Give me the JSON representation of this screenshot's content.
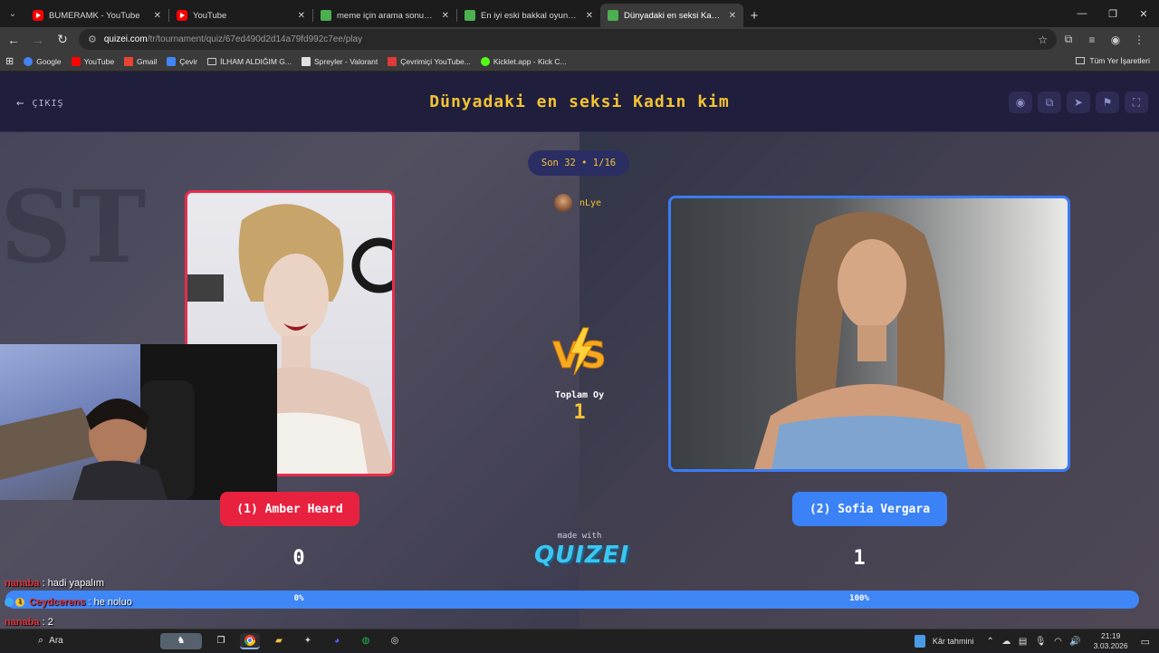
{
  "browser": {
    "tabs": [
      {
        "title": "BUMERAMK - YouTube",
        "icon": "youtube-icon",
        "active": false
      },
      {
        "title": "YouTube",
        "icon": "youtube-icon",
        "active": false
      },
      {
        "title": "meme için arama sonuçları - Q",
        "icon": "quizei-icon",
        "active": false
      },
      {
        "title": "En iyi eski bakkal oyuncakları -",
        "icon": "quizei-icon",
        "active": false
      },
      {
        "title": "Dünyadaki en seksi Kadın kim -",
        "icon": "quizei-icon",
        "active": true
      }
    ],
    "url_domain": "quizei.com",
    "url_path": "/tr/tournament/quiz/67ed490d2d14a79fd992c7ee/play",
    "bookmarks": [
      {
        "label": "Google",
        "color": "#4285f4"
      },
      {
        "label": "YouTube",
        "color": "#ff0000"
      },
      {
        "label": "Gmail",
        "color": "#ea4335"
      },
      {
        "label": "Çevir",
        "color": "#4285f4"
      },
      {
        "label": "İLHAM ALDIĞIM G...",
        "color": "folder"
      },
      {
        "label": "Spreyler - Valorant",
        "color": "#e0e0e0"
      },
      {
        "label": "Çevrimiçi YouTube...",
        "color": "#e03a3a"
      },
      {
        "label": "Kicklet.app - Kick C...",
        "color": "#53fc18"
      }
    ],
    "bookmarks_all": "Tüm Yer İşaretleri"
  },
  "app": {
    "exit_label": "ÇIKIŞ",
    "title": "Dünyadaki en seksi Kadın kim",
    "round": "Son 32 • 1/16",
    "username": "nLye",
    "total_votes_label": "Toplam Oy",
    "total_votes": "1",
    "vs_label": "VS",
    "left": {
      "name": "(1) Amber Heard",
      "score": "0",
      "percent": "0%",
      "color": "#e8213f"
    },
    "right": {
      "name": "(2) Sofia Vergara",
      "score": "1",
      "percent": "100%",
      "color": "#3b82f6"
    },
    "left_share": 0,
    "made_with": "made with",
    "brand": "QUIZEI",
    "bg_letters": "ST"
  },
  "chat": [
    {
      "user": "nanaba",
      "color": "#e0353b",
      "message": ": hadi yapalım"
    },
    {
      "user": "Ceydcerens",
      "color": "#e0353b",
      "message": ": he noluo"
    },
    {
      "user": "nanaba",
      "color": "#e0353b",
      "message": ": 2"
    }
  ],
  "taskbar": {
    "search": "Ara",
    "weather": "Kâr tahmini",
    "time": "21:19",
    "date": "3.03.2026"
  }
}
